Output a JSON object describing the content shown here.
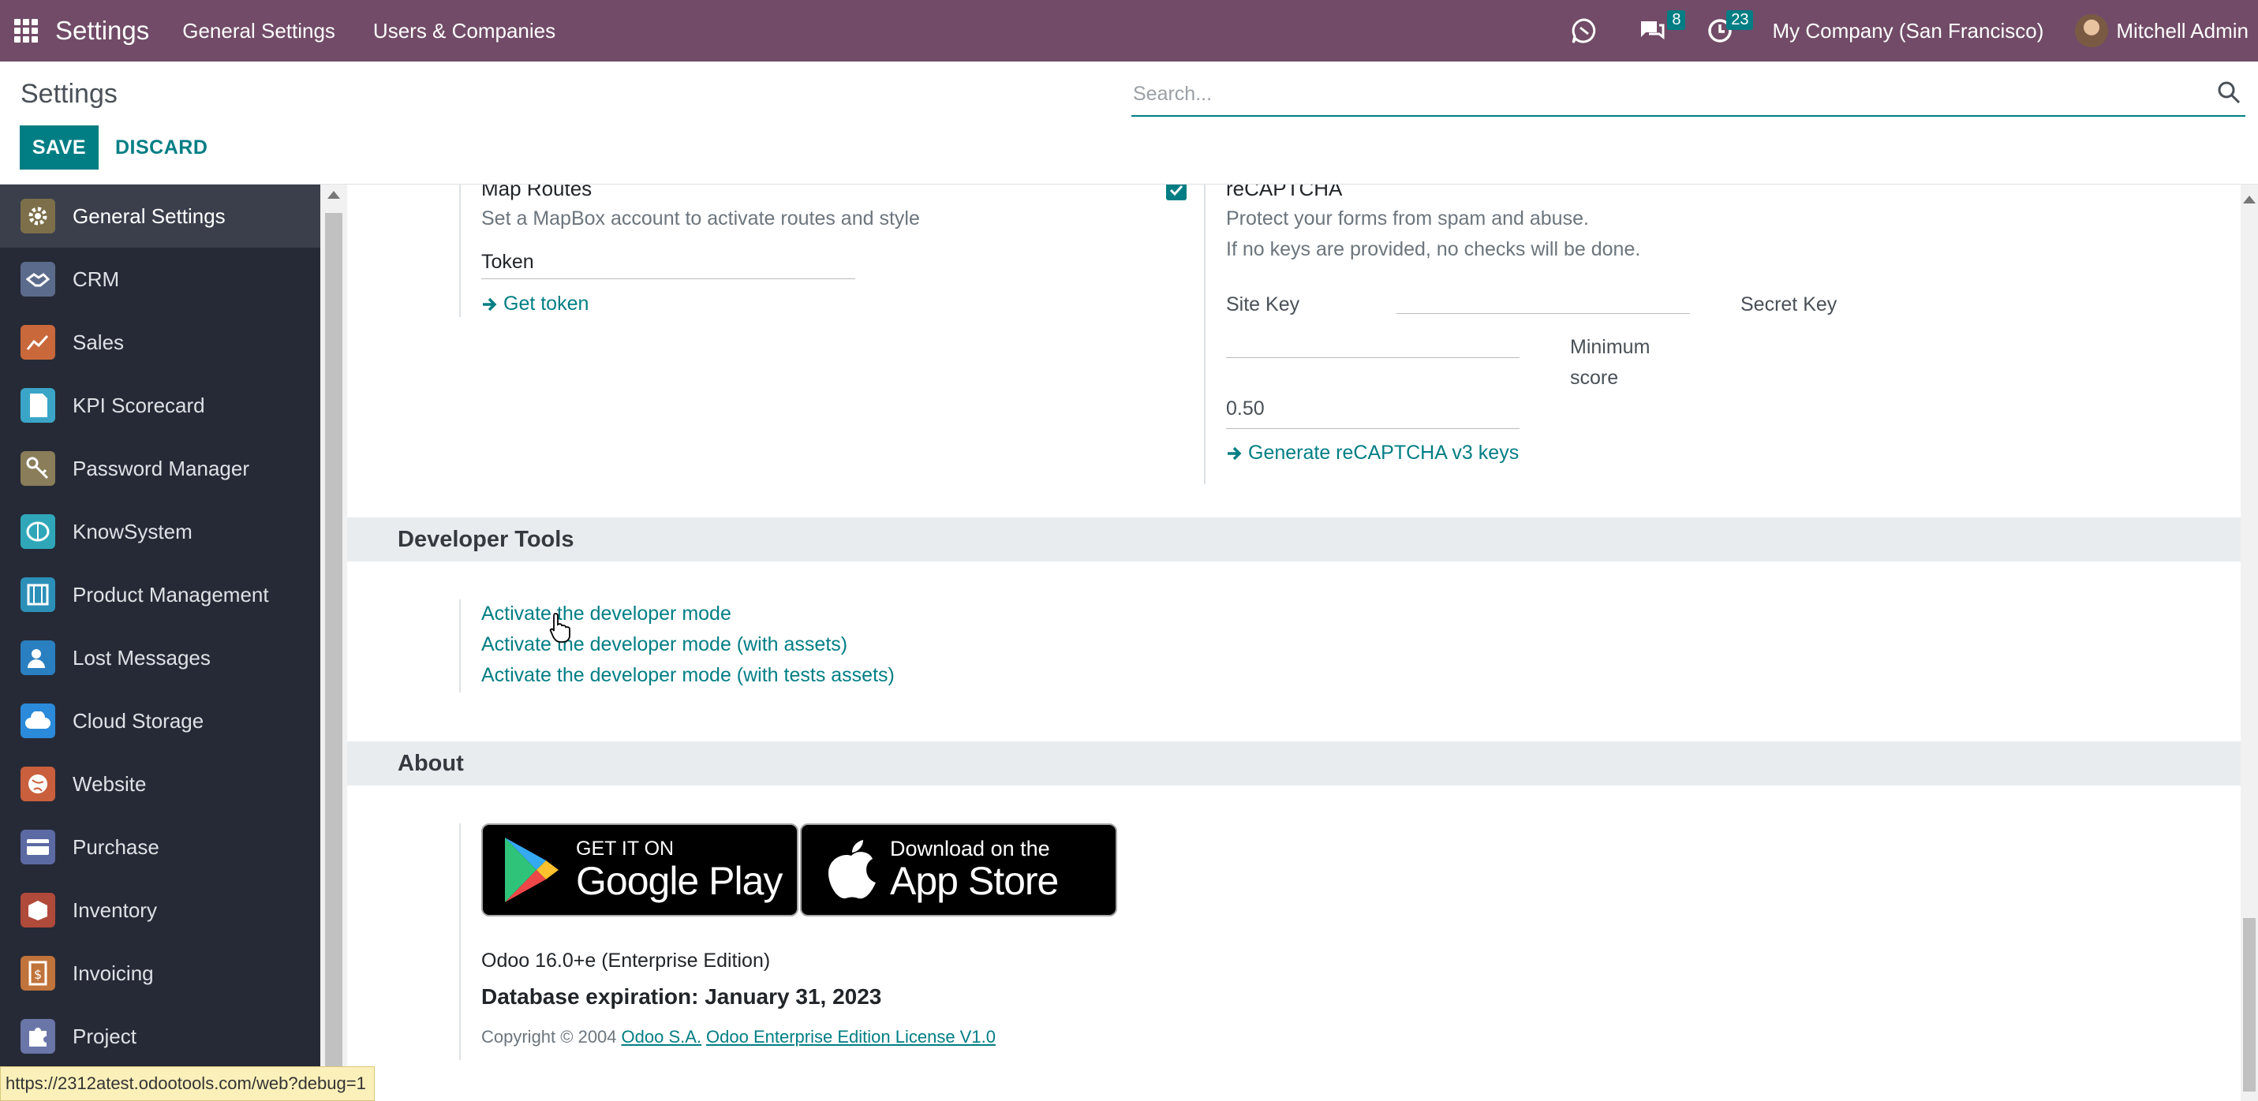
{
  "navbar": {
    "app_title": "Settings",
    "menu": [
      "General Settings",
      "Users & Companies"
    ],
    "chat_badge": "8",
    "activity_badge": "23",
    "company": "My Company (San Francisco)",
    "user": "Mitchell Admin",
    "color": "#714b67"
  },
  "control": {
    "title": "Settings",
    "save_label": "SAVE",
    "discard_label": "DISCARD",
    "search_placeholder": "Search..."
  },
  "sidebar": {
    "items": [
      {
        "label": "General Settings",
        "icon": "gear-icon",
        "color": "#7c6f4a"
      },
      {
        "label": "CRM",
        "icon": "handshake-icon",
        "color": "#5b6b8c"
      },
      {
        "label": "Sales",
        "icon": "chart-up-icon",
        "color": "#c9693b"
      },
      {
        "label": "KPI Scorecard",
        "icon": "document-icon",
        "color": "#3aa5c7"
      },
      {
        "label": "Password Manager",
        "icon": "keys-icon",
        "color": "#8a7d5a"
      },
      {
        "label": "KnowSystem",
        "icon": "brain-icon",
        "color": "#2fa7b9"
      },
      {
        "label": "Product Management",
        "icon": "product-icon",
        "color": "#2c8fb8"
      },
      {
        "label": "Lost Messages",
        "icon": "user-question-icon",
        "color": "#2a7fc0"
      },
      {
        "label": "Cloud Storage",
        "icon": "cloud-icon",
        "color": "#2b8ad9"
      },
      {
        "label": "Website",
        "icon": "globe-icon",
        "color": "#c95f3c"
      },
      {
        "label": "Purchase",
        "icon": "card-icon",
        "color": "#5c6aa3"
      },
      {
        "label": "Inventory",
        "icon": "box-icon",
        "color": "#b04a3a"
      },
      {
        "label": "Invoicing",
        "icon": "invoice-icon",
        "color": "#c0733a"
      },
      {
        "label": "Project",
        "icon": "puzzle-icon",
        "color": "#6a76a8"
      }
    ]
  },
  "map_routes": {
    "title": "Map Routes",
    "description": "Set a MapBox account to activate routes and style",
    "token_label": "Token",
    "get_token": "Get token"
  },
  "recaptcha": {
    "title": "reCAPTCHA",
    "description1": "Protect your forms from spam and abuse.",
    "description2": "If no keys are provided, no checks will be done.",
    "site_key_label": "Site Key",
    "secret_key_label": "Secret Key",
    "min_score_label1": "Minimum",
    "min_score_label2": "score",
    "min_score_value": "0.50",
    "generate_link": "Generate reCAPTCHA v3 keys"
  },
  "developer_tools": {
    "heading": "Developer Tools",
    "links": [
      "Activate the developer mode",
      "Activate the developer mode (with assets)",
      "Activate the developer mode (with tests assets)"
    ]
  },
  "about": {
    "heading": "About",
    "google_small": "GET IT ON",
    "google_big": "Google Play",
    "apple_small": "Download on the",
    "apple_big": "App Store",
    "version": "Odoo 16.0+e (Enterprise Edition)",
    "expiration": "Database expiration: January 31, 2023",
    "copyright": "Copyright © 2004",
    "company_link": "Odoo S.A.",
    "license_link": "Odoo Enterprise Edition License V1.0"
  },
  "status_url": "https://2312atest.odootools.com/web?debug=1"
}
